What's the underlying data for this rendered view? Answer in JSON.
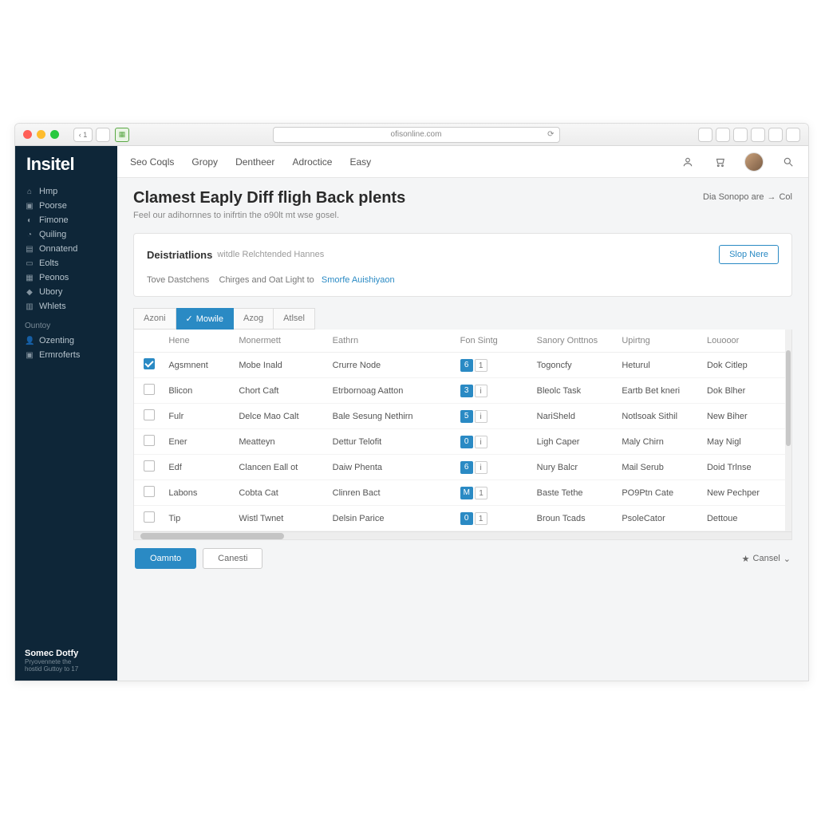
{
  "browser": {
    "address": "ofisonline.com",
    "nav_back_label": "‹ 1"
  },
  "brand": "Insitel",
  "topnav": {
    "items": [
      "Seo Coqls",
      "Gropy",
      "Dentheer",
      "Adroctice",
      "Easy"
    ]
  },
  "sidebar": {
    "items": [
      {
        "icon": "⌂",
        "label": "Hmp"
      },
      {
        "icon": "▣",
        "label": "Poorse"
      },
      {
        "icon": "◐",
        "label": "Fimone"
      },
      {
        "icon": "◔",
        "label": "Quiling"
      },
      {
        "icon": "▤",
        "label": "Onnatend"
      },
      {
        "icon": "▭",
        "label": "Eolts"
      },
      {
        "icon": "▦",
        "label": "Peonos"
      },
      {
        "icon": "◆",
        "label": "Ubory"
      },
      {
        "icon": "▥",
        "label": "Whlets"
      }
    ],
    "section2_label": "Ountoy",
    "section2_items": [
      {
        "icon": "👤",
        "label": "Ozenting"
      },
      {
        "icon": "▣",
        "label": "Ermroferts"
      }
    ],
    "footer": {
      "title": "Somec Dotfy",
      "sub1": "Pryovennete the",
      "sub2": "hostid Guttoy to 17"
    }
  },
  "page": {
    "title": "Clamest Eaply Diff fligh Back plents",
    "subtitle": "Feel our adihornnes to inifrtin the o90lt mt wse gosel.",
    "header_action": "Dia Sonopo are",
    "header_action_coll": "Col"
  },
  "dest": {
    "title": "Deistriatlions",
    "subtitle": "witdle Relchtended Hannes",
    "button": "Slop Nere",
    "line_prefix": "Tove Dastchens",
    "line_mid": "Chirges and Oat Light to",
    "line_link": "Smorfe Auishiyaon"
  },
  "tabs": [
    "Azoni",
    "Mowile",
    "Azog",
    "Atlsel"
  ],
  "active_tab_index": 1,
  "table": {
    "columns": [
      "Hene",
      "Monermett",
      "Eathrn",
      "Fon Sintg",
      "Sanory Onttnos",
      "Upirtng",
      "Louooor"
    ],
    "rows": [
      {
        "checked": true,
        "name": "Agsmnent",
        "mgmt": "Mobe Inald",
        "eathrn": "Crurre Node",
        "fan_badge": "6",
        "fan_side": "1",
        "senory": "Togoncfy",
        "upk": "Heturul",
        "loc": "Dok Citlep"
      },
      {
        "checked": false,
        "name": "Blicon",
        "mgmt": "Chort Caft",
        "eathrn": "Etrbornoag Aatton",
        "fan_badge": "3",
        "fan_side": "i",
        "senory": "Bleolc Task",
        "upk": "Eartb Bet kneri",
        "loc": "Dok Blher"
      },
      {
        "checked": false,
        "name": "Fulr",
        "mgmt": "Delce Mao Calt",
        "eathrn": "Bale Sesung Nethirn",
        "fan_badge": "5",
        "fan_side": "i",
        "senory": "NariSheld",
        "upk": "Notlsoak Sithil",
        "loc": "New Biher"
      },
      {
        "checked": false,
        "name": "Ener",
        "mgmt": "Meatteyn",
        "eathrn": "Dettur Telofit",
        "fan_badge": "0",
        "fan_side": "i",
        "senory": "Ligh Caper",
        "upk": "Maly Chirn",
        "loc": "May Nigl"
      },
      {
        "checked": false,
        "name": "Edf",
        "mgmt": "Clancen Eall ot",
        "eathrn": "Daiw Phenta",
        "fan_badge": "6",
        "fan_side": "i",
        "senory": "Nury Balcr",
        "upk": "Mail Serub",
        "loc": "Doid Trlnse"
      },
      {
        "checked": false,
        "name": "Labons",
        "mgmt": "Cobta Cat",
        "eathrn": "Clinren Bact",
        "fan_badge": "M",
        "fan_side": "1",
        "senory": "Baste Tethe",
        "upk": "PO9Ptn Cate",
        "loc": "New Pechper"
      },
      {
        "checked": false,
        "name": "Tip",
        "mgmt": "Wistl Twnet",
        "eathrn": "Delsin Parice",
        "fan_badge": "0",
        "fan_side": "1",
        "senory": "Broun Tcads",
        "upk": "PsoleCator",
        "loc": "Dettoue"
      }
    ]
  },
  "footer": {
    "primary": "Oamnto",
    "secondary": "Canesti",
    "right_label": "Cansel"
  }
}
